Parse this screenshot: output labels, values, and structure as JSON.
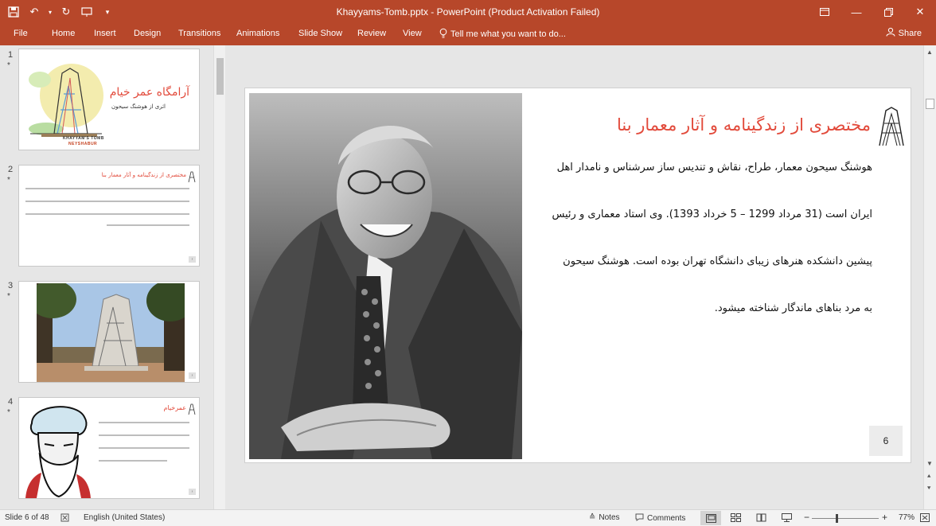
{
  "window": {
    "title": "Khayyams-Tomb.pptx - PowerPoint (Product Activation Failed)"
  },
  "ribbon": {
    "tabs": [
      "File",
      "Home",
      "Insert",
      "Design",
      "Transitions",
      "Animations",
      "Slide Show",
      "Review",
      "View"
    ],
    "tell_me": "Tell me what you want to do...",
    "share": "Share"
  },
  "thumbnails": [
    {
      "number": "1",
      "title": "آرامگاه عمر خیام",
      "subtitle": "اثری از هوشنگ سیحون",
      "brand": "KHAYYAM'S TOMB",
      "brand_sub": "NEYSHABUR"
    },
    {
      "number": "2",
      "title": "مختصری از زندگینامه و آثار معمار بنا"
    },
    {
      "number": "3"
    },
    {
      "number": "4",
      "title": "عمرخیام"
    }
  ],
  "slide": {
    "title": "مختصری از زندگینامه و آثار معمار بنا",
    "paragraph_lines": [
      "هوشنگ سیحون معمار، طراح، نقاش و تندیس ساز سرشناس و نامدار اهل",
      "ایران است (31 مرداد 1299 – 5 خرداد 1393). وی استاد معماری و رئیس",
      "پیشین دانشکده هنرهای زیبای دانشگاه تهران بوده است. هوشنگ سیحون",
      "به مرد بناهای ماندگار شناخته میشود."
    ],
    "number": "6"
  },
  "statusbar": {
    "slide_info": "Slide 6 of 48",
    "language": "English (United States)",
    "notes": "Notes",
    "comments": "Comments",
    "zoom": "77%"
  },
  "colors": {
    "accent": "#b7472a",
    "title_red": "#e24a3b"
  }
}
